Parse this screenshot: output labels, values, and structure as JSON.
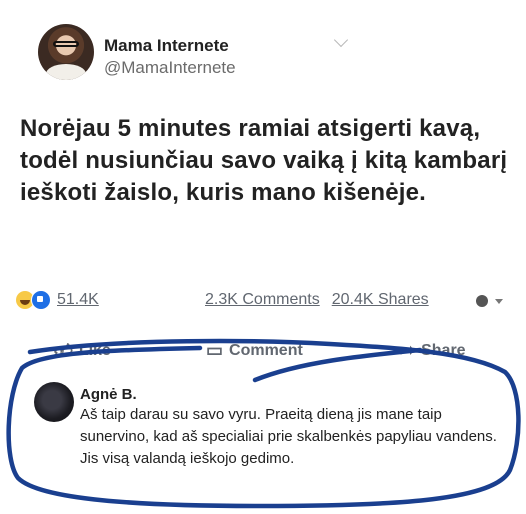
{
  "post": {
    "author_name": "Mama Internete",
    "author_handle": "@MamaInternete",
    "text": "Norėjau 5 minutes ramiai atsigerti kavą, todėl nusiunčiau savo vaiką į kitą kambarį ieškoti žaislo, kuris mano kišenėje."
  },
  "stats": {
    "reactions": "51.4K",
    "comments": "2.3K Comments",
    "shares": "20.4K Shares"
  },
  "actions": {
    "like": "Like",
    "comment": "Comment",
    "share": "Share"
  },
  "comment": {
    "name": "Agnė B.",
    "text": "Aš taip darau su savo vyru. Praeitą dieną jis mane taip sunervino, kad aš specialiai prie skalbenkės papyliau vandens. Jis visą valandą ieškojo gedimo."
  },
  "icons": {
    "like": "thumbs-up-icon",
    "comment": "speech-bubble-icon",
    "share": "share-arrow-icon",
    "audience": "globe-icon"
  },
  "colors": {
    "scribble": "#1a3f8f",
    "meta_text": "#616770"
  }
}
